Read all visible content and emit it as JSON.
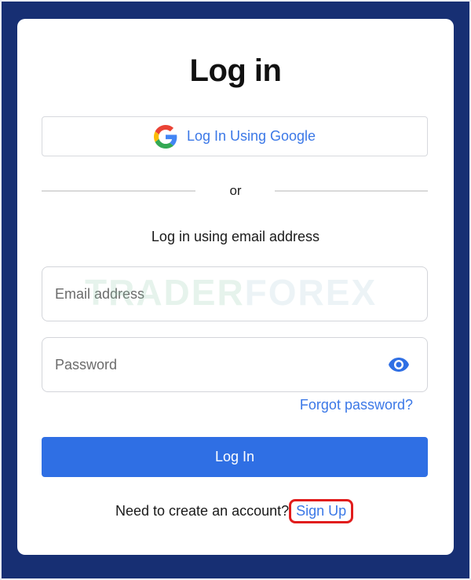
{
  "header": {
    "title": "Log in"
  },
  "google_login": {
    "label": "Log In Using Google",
    "icon": "google-g-icon"
  },
  "divider": {
    "text": "or"
  },
  "email_section": {
    "heading": "Log in using email address"
  },
  "email_field": {
    "value": "",
    "placeholder": "Email address"
  },
  "password_field": {
    "value": "",
    "placeholder": "Password",
    "toggle_icon": "eye-icon"
  },
  "forgot_password": {
    "label": "Forgot password?"
  },
  "login_button": {
    "label": "Log In"
  },
  "signup": {
    "prompt": "Need to create an account?",
    "link_label": "Sign Up"
  },
  "watermark": {
    "text_a": "TRADER",
    "text_b": "FOREX"
  },
  "colors": {
    "background": "#172f73",
    "accent": "#2f6fe4",
    "link": "#3b78e7",
    "highlight": "#e11d1d"
  }
}
